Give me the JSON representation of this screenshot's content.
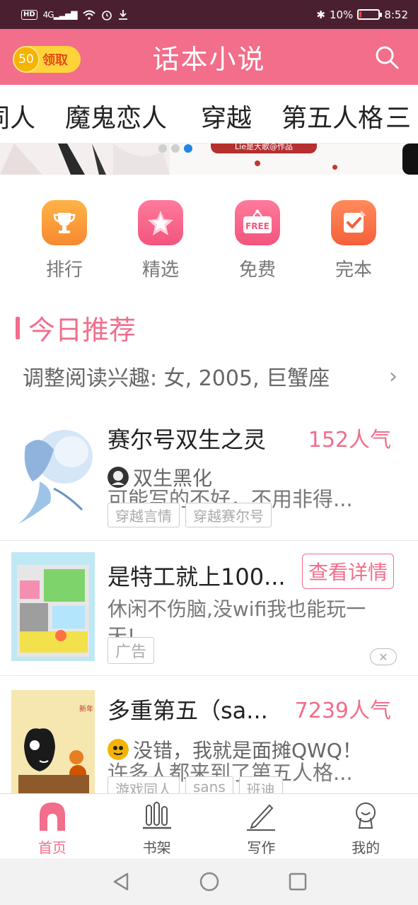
{
  "status_bar": {
    "network": "HD",
    "signal": "4G",
    "battery": "10%",
    "battery_level": 0.1,
    "time": "8:52"
  },
  "header": {
    "coin_count": "50",
    "claim_label": "领取",
    "title": "话本小说",
    "search_icon": "search-icon"
  },
  "categories": [
    "同人",
    "魔鬼恋人",
    "穿越",
    "第五人格",
    "三"
  ],
  "banner": {
    "chip_text": "Lie是大歌@作品",
    "dots_total": 3,
    "active_dot": 2
  },
  "quick_entries": [
    {
      "label": "排行",
      "icon": "trophy-icon",
      "color": "#f7892f"
    },
    {
      "label": "精选",
      "icon": "star-icon",
      "color": "#f2557d"
    },
    {
      "label": "免费",
      "icon": "free-tag-icon",
      "color": "#f2557d"
    },
    {
      "label": "完本",
      "icon": "check-badge-icon",
      "color": "#f5603a"
    }
  ],
  "section": {
    "title": "今日推荐",
    "interest": "调整阅读兴趣: 女, 2005, 巨蟹座"
  },
  "books": [
    {
      "title": "赛尔号双生之灵",
      "popularity": "152人气",
      "author": "双生黑化",
      "description": "可能写的不好，不用非得...",
      "tags": [
        "穿越言情",
        "穿越赛尔号"
      ]
    },
    {
      "title": "多重第五（sa...",
      "popularity": "7239人气",
      "author": "没错，我就是面摊QWQ！",
      "description": "许多人都来到了第五人格...",
      "tags": [
        "游戏同人",
        "sans",
        "班迪"
      ]
    }
  ],
  "ad": {
    "title": "是特工就上100...",
    "detail_button": "查看详情",
    "description": "休闲不伤脑,没wifi我也能玩一天!",
    "tag": "广告",
    "close_icon": "close-icon"
  },
  "bottom_nav": [
    {
      "label": "首页",
      "icon": "home-icon",
      "active": true
    },
    {
      "label": "书架",
      "icon": "bookshelf-icon",
      "active": false
    },
    {
      "label": "写作",
      "icon": "pen-icon",
      "active": false
    },
    {
      "label": "我的",
      "icon": "profile-icon",
      "active": false
    }
  ],
  "system_nav": [
    "back-icon",
    "home-circle-icon",
    "recent-apps-icon"
  ]
}
